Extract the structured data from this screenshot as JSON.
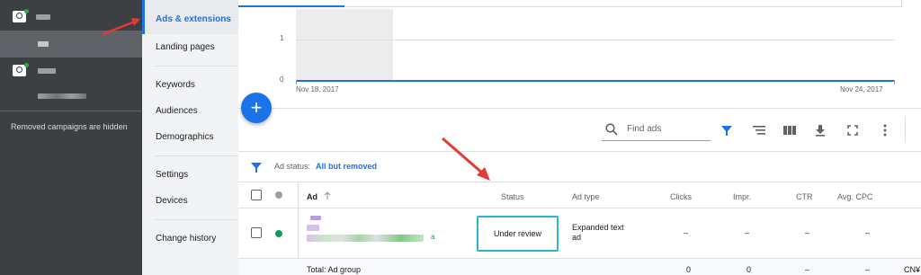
{
  "tree": {
    "removed_note": "Removed campaigns are hidden"
  },
  "menu": {
    "items": [
      "Ads & extensions",
      "Landing pages",
      "Keywords",
      "Audiences",
      "Demographics",
      "Settings",
      "Devices",
      "Change history"
    ]
  },
  "chart": {
    "y_ticks": [
      "1",
      "0"
    ],
    "x_start": "Nov 18, 2017",
    "x_end": "Nov 24, 2017"
  },
  "toolbar": {
    "search_placeholder": "Find ads"
  },
  "filter": {
    "label": "Ad status:",
    "value": "All but removed"
  },
  "table": {
    "headers": [
      "Ad",
      "Status",
      "Ad type",
      "Clicks",
      "Impr.",
      "CTR",
      "Avg. CPC"
    ],
    "row": {
      "ad_suffix": "a",
      "status": "Under review",
      "ad_type_line1": "Expanded text",
      "ad_type_line2": "ad",
      "clicks": "–",
      "impr": "–",
      "ctr": "–",
      "avg_cpc": "–"
    },
    "total": {
      "label": "Total: Ad group",
      "clicks": "0",
      "impr": "0",
      "ctr": "–",
      "avg_cpc": "–",
      "extra": "CN¥"
    }
  },
  "colors": {
    "accent": "#1a73e8",
    "status_box": "#29b6d5",
    "enabled_dot": "#0f9d58",
    "arrow": "#e53935"
  }
}
